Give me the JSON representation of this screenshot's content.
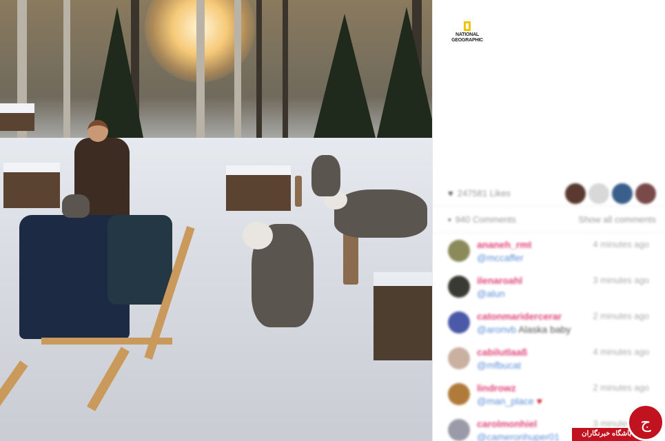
{
  "brand": {
    "logo_line1": "NATIONAL",
    "logo_line2": "GEOGRAPHIC",
    "frame_color": "#f3c300"
  },
  "stats": {
    "likes_text": "247581 Likes",
    "comments_text": "940 Comments",
    "show_all": "Show all comments",
    "like_icon": "heart-icon",
    "comment_icon": "speech-bubble-icon"
  },
  "comments": [
    {
      "user": "ananeh_rmt",
      "time": "4 minutes ago",
      "text": "@mccaffer",
      "extra": ""
    },
    {
      "user": "ilenaroahl",
      "time": "3 minutes ago",
      "text": "@alun",
      "extra": ""
    },
    {
      "user": "catonmaridercerar",
      "time": "2 minutes ago",
      "text": "@aronvb",
      "extra": "Alaska baby"
    },
    {
      "user": "cabilutlaaß",
      "time": "4 minutes ago",
      "text": "@mfbucat",
      "extra": ""
    },
    {
      "user": "lindrowz",
      "time": "2 minutes ago",
      "text": "@man_place",
      "extra": ""
    },
    {
      "user": "carolmonhiel",
      "time": "3 minutes ago",
      "text": "@cameronhuper01",
      "extra": ""
    }
  ],
  "watermark": {
    "label": "باشگاه خبرنگاران",
    "glyph": "ج",
    "color": "#c1121f"
  },
  "colors": {
    "username": "#e0457a",
    "mention": "#5b8fd8",
    "muted": "#999999"
  }
}
